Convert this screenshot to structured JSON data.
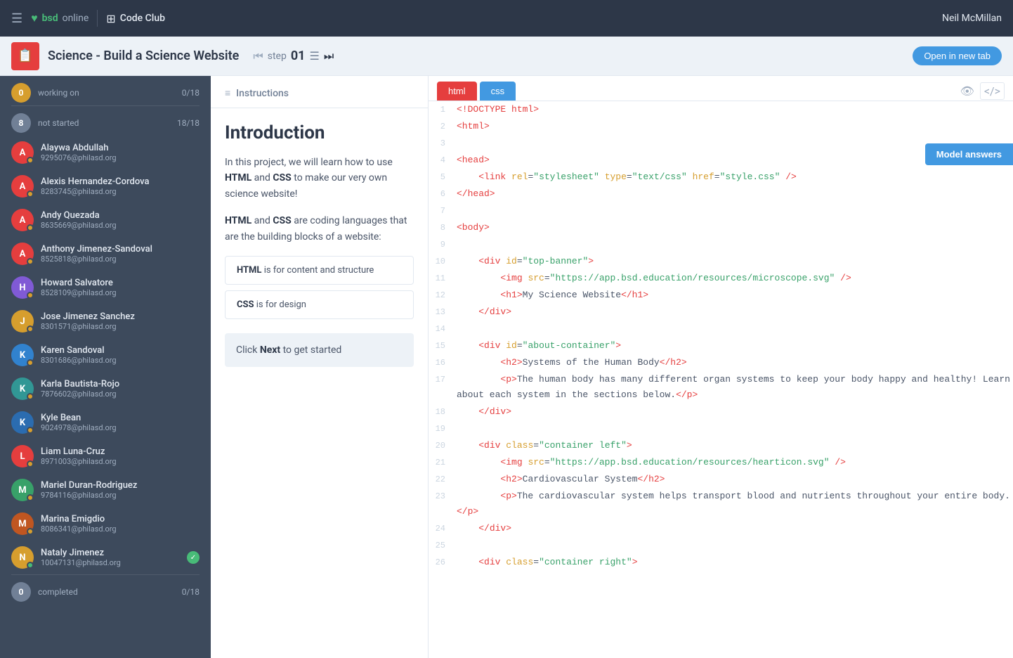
{
  "topBar": {
    "hamburger": "≡",
    "bsdLabel": "bsd",
    "bsdSub": "online",
    "codeClubLabel": "Code Club",
    "userName": "Neil McMillan"
  },
  "projectHeader": {
    "title": "Science - Build a Science Website",
    "stepLabel": "step",
    "stepNum": "01",
    "openNewTabLabel": "Open in new tab"
  },
  "modelAnswers": {
    "label": "Model answers"
  },
  "sidebar": {
    "workingOnLabel": "working on",
    "workingOnCount": "0",
    "workingOnTotal": "18",
    "notStartedLabel": "not started",
    "notStartedCount": "18",
    "notStartedTotal": "18",
    "completedLabel": "completed",
    "completedCount": "0",
    "completedTotal": "18",
    "students": [
      {
        "name": "Alaywa Abdullah",
        "id": "9295076@philasd.org",
        "avatar": "A",
        "avatarClass": "avatar-a",
        "dot": "dot-yellow"
      },
      {
        "name": "Alexis Hernandez-Cordova",
        "id": "8283745@philasd.org",
        "avatar": "A",
        "avatarClass": "avatar-a",
        "dot": "dot-yellow"
      },
      {
        "name": "Andy Quezada",
        "id": "8635669@philasd.org",
        "avatar": "A",
        "avatarClass": "avatar-a",
        "dot": "dot-yellow"
      },
      {
        "name": "Anthony Jimenez-Sandoval",
        "id": "8525818@philasd.org",
        "avatar": "A",
        "avatarClass": "avatar-a",
        "dot": "dot-yellow"
      },
      {
        "name": "Howard Salvatore",
        "id": "8528109@philasd.org",
        "avatar": "H",
        "avatarClass": "avatar-h",
        "dot": "dot-yellow"
      },
      {
        "name": "Jose Jimenez Sanchez",
        "id": "8301571@philasd.org",
        "avatar": "J",
        "avatarClass": "avatar-j",
        "dot": "dot-yellow"
      },
      {
        "name": "Karen Sandoval",
        "id": "8301686@philasd.org",
        "avatar": "K",
        "avatarClass": "avatar-k1",
        "dot": "dot-yellow"
      },
      {
        "name": "Karla Bautista-Rojo",
        "id": "7876602@philasd.org",
        "avatar": "K",
        "avatarClass": "avatar-k2",
        "dot": "dot-yellow"
      },
      {
        "name": "Kyle Bean",
        "id": "9024978@philasd.org",
        "avatar": "K",
        "avatarClass": "avatar-k3",
        "dot": "dot-yellow"
      },
      {
        "name": "Liam Luna-Cruz",
        "id": "8971003@philasd.org",
        "avatar": "L",
        "avatarClass": "avatar-l",
        "dot": "dot-yellow"
      },
      {
        "name": "Mariel Duran-Rodriguez",
        "id": "9784116@philasd.org",
        "avatar": "M",
        "avatarClass": "avatar-m1",
        "dot": "dot-yellow"
      },
      {
        "name": "Marina Emigdio",
        "id": "8086341@philasd.org",
        "avatar": "M",
        "avatarClass": "avatar-m2",
        "dot": "dot-yellow"
      },
      {
        "name": "Nataly Jimenez",
        "id": "10047131@philasd.org",
        "avatar": "N",
        "avatarClass": "avatar-n",
        "dot": "dot-green",
        "completed": true
      }
    ]
  },
  "instructions": {
    "headerIcon": "≡",
    "headerTitle": "Instructions",
    "introTitle": "Introduction",
    "para1a": "In this project, we will learn how to use ",
    "para1b": "HTML",
    "para1c": " and ",
    "para1d": "CSS",
    "para1e": " to make our very own science website!",
    "para2a": "",
    "para2b": "HTML",
    "para2c": " and ",
    "para2d": "CSS",
    "para2e": " are coding languages that are the building blocks of a website:",
    "htmlBlock": "HTML  is for content and structure",
    "cssBlock": "CSS  is for design",
    "nextText": "Click ",
    "nextKeyword": "Next",
    "nextTextEnd": " to get started"
  },
  "editor": {
    "htmlTabLabel": "html",
    "cssTabLabel": "css",
    "lines": [
      {
        "num": "1",
        "code": "<!DOCTYPE html>"
      },
      {
        "num": "2",
        "code": "<html>"
      },
      {
        "num": "3",
        "code": ""
      },
      {
        "num": "4",
        "code": "<head>"
      },
      {
        "num": "5",
        "code": "    <link rel=\"stylesheet\" type=\"text/css\" href=\"style.css\" />"
      },
      {
        "num": "6",
        "code": "</head>"
      },
      {
        "num": "7",
        "code": ""
      },
      {
        "num": "8",
        "code": "<body>"
      },
      {
        "num": "9",
        "code": ""
      },
      {
        "num": "10",
        "code": "    <div id=\"top-banner\">"
      },
      {
        "num": "11",
        "code": "        <img src=\"https://app.bsd.education/resources/microscope.svg\" />"
      },
      {
        "num": "12",
        "code": "        <h1>My Science Website</h1>"
      },
      {
        "num": "13",
        "code": "    </div>"
      },
      {
        "num": "14",
        "code": ""
      },
      {
        "num": "15",
        "code": "    <div id=\"about-container\">"
      },
      {
        "num": "16",
        "code": "        <h2>Systems of the Human Body</h2>"
      },
      {
        "num": "17",
        "code": "        <p>The human body has many different organ systems to keep your body happy and healthy! Learn about each system in the sections below.</p>"
      },
      {
        "num": "18",
        "code": "    </div>"
      },
      {
        "num": "19",
        "code": ""
      },
      {
        "num": "20",
        "code": "    <div class=\"container left\">"
      },
      {
        "num": "21",
        "code": "        <img src=\"https://app.bsd.education/resources/hearticon.svg\" />"
      },
      {
        "num": "22",
        "code": "        <h2>Cardiovascular System</h2>"
      },
      {
        "num": "23",
        "code": "        <p>The cardiovascular system helps transport blood and nutrients throughout your entire body. </p>"
      },
      {
        "num": "24",
        "code": "    </div>"
      },
      {
        "num": "25",
        "code": ""
      },
      {
        "num": "26",
        "code": "    <div class=\"container right\">"
      }
    ]
  }
}
